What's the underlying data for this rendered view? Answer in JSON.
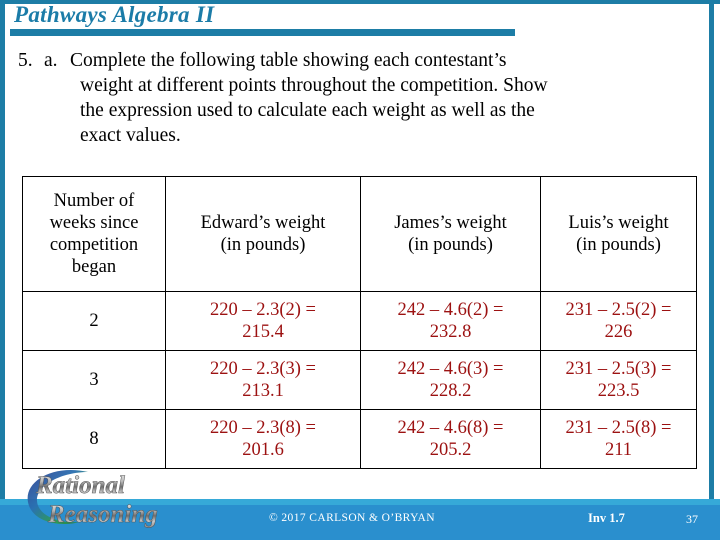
{
  "slide": {
    "title": "Pathways Algebra II",
    "accent_color": "#1d7da6",
    "title_color": "#1b7ca8",
    "answer_color": "#9c1111",
    "footer_bar_color": "#2a8fce",
    "footer_accent_color": "#36a9d8"
  },
  "question": {
    "number": "5.",
    "letter": "a.",
    "line1": "Complete the following table showing each contestant’s",
    "line2": "weight at different points throughout the competition. Show",
    "line3": "the expression used to calculate each weight as well as the",
    "line4": "exact values."
  },
  "table": {
    "headers": [
      "Number of weeks since competition began",
      "Edward’s weight (in pounds)",
      "James’s weight (in pounds)",
      "Luis’s weight (in pounds)"
    ],
    "header_lines": {
      "weeks": [
        "Number of",
        "weeks since",
        "competition",
        "began"
      ],
      "edward": [
        "Edward’s weight",
        "(in pounds)"
      ],
      "james": [
        "James’s weight",
        "(in pounds)"
      ],
      "luis": [
        "Luis’s weight",
        "(in pounds)"
      ]
    },
    "rows": [
      {
        "weeks": "2",
        "edward_expr": "220 – 2.3(2) =",
        "edward_value": "215.4",
        "james_expr": "242 – 4.6(2) =",
        "james_value": "232.8",
        "luis_expr": "231 – 2.5(2) =",
        "luis_value": "226"
      },
      {
        "weeks": "3",
        "edward_expr": "220 – 2.3(3) =",
        "edward_value": "213.1",
        "james_expr": "242 – 4.6(3) =",
        "james_value": "228.2",
        "luis_expr": "231 – 2.5(3) =",
        "luis_value": "223.5"
      },
      {
        "weeks": "8",
        "edward_expr": "220 – 2.3(8) =",
        "edward_value": "201.6",
        "james_expr": "242 – 4.6(8) =",
        "james_value": "205.2",
        "luis_expr": "231 – 2.5(8) =",
        "luis_value": "211"
      }
    ]
  },
  "logo": {
    "line1": "Rational",
    "line2": "Reasoning"
  },
  "footer": {
    "copyright": "© 2017 CARLSON & O’BRYAN",
    "investigation": "Inv 1.7",
    "page_number": "37"
  }
}
